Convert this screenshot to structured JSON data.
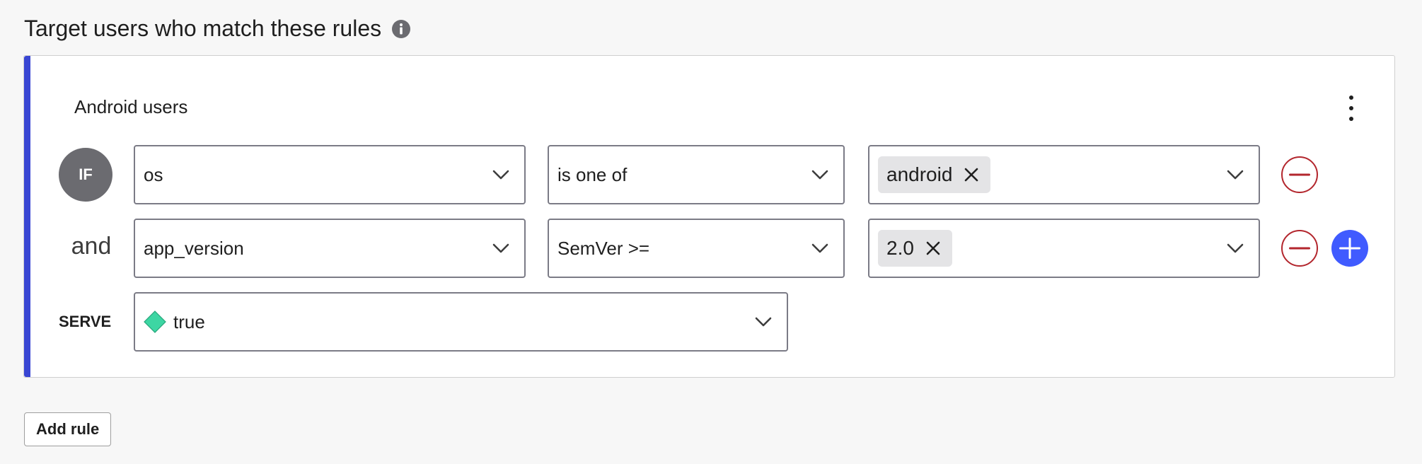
{
  "section": {
    "title": "Target users who match these rules",
    "info_icon": "info-icon"
  },
  "rule": {
    "name": "Android users",
    "accent_color": "#3946d3",
    "menu_icon": "kebab-menu-icon",
    "if_label": "IF",
    "and_label": "and",
    "serve_label": "SERVE",
    "clauses": [
      {
        "attribute": "os",
        "operator": "is one of",
        "values": [
          "android"
        ]
      },
      {
        "attribute": "app_version",
        "operator": "SemVer >=",
        "values": [
          "2.0"
        ]
      }
    ],
    "serve": {
      "value": "true",
      "variation_color": "#3dd6a3",
      "icon": "diamond-icon"
    }
  },
  "buttons": {
    "add_rule": "Add rule",
    "remove_clause_icon": "minus-circle-icon",
    "add_clause_icon": "plus-circle-icon",
    "remove_color": "#b3262d",
    "add_color": "#405bff"
  }
}
